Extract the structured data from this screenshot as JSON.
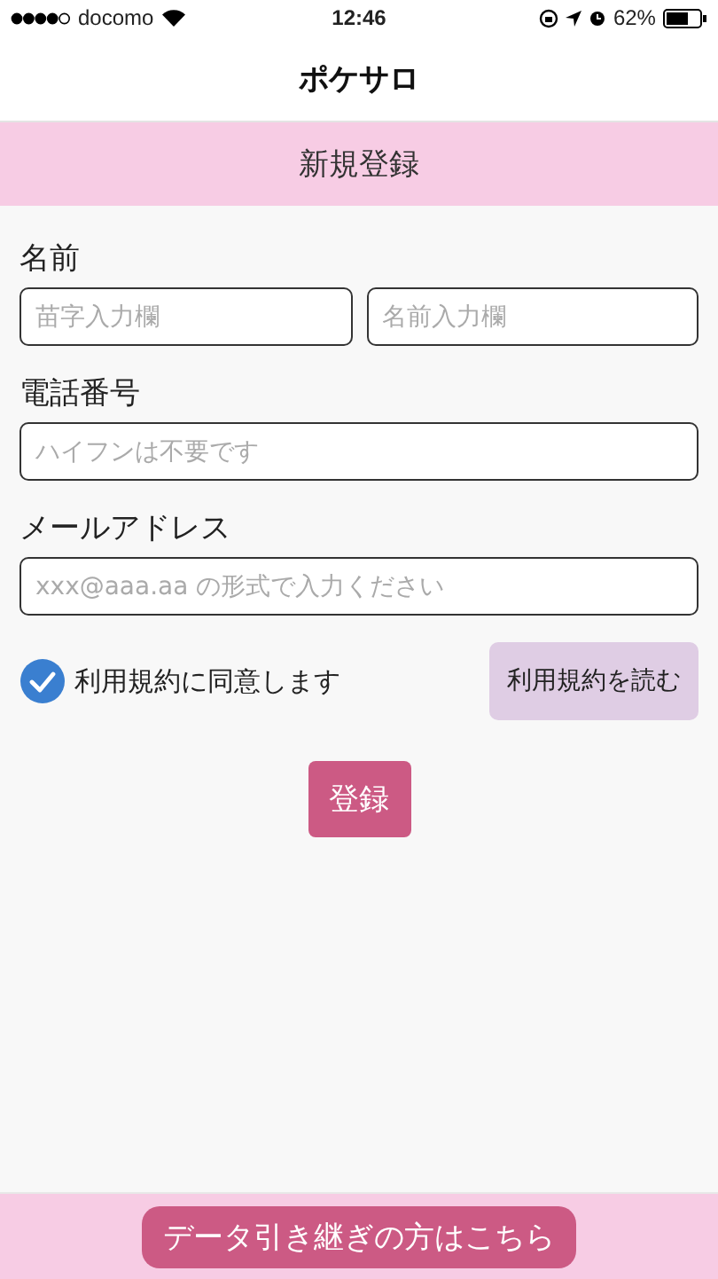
{
  "status_bar": {
    "carrier": "docomo",
    "time": "12:46",
    "battery": "62%"
  },
  "nav_bar": {
    "title": "ポケサロ"
  },
  "header": {
    "title": "新規登録"
  },
  "form": {
    "fields": [
      {
        "label": "名前",
        "inputs": [
          {
            "placeholder": "苗字入力欄"
          },
          {
            "placeholder": "名前入力欄"
          }
        ]
      },
      {
        "label": "電話番号",
        "inputs": [
          {
            "placeholder": "ハイフンは不要です"
          }
        ]
      },
      {
        "label": "メールアドレス",
        "inputs": [
          {
            "placeholder": "xxx@aaa.aa の形式で入力ください"
          }
        ]
      }
    ],
    "agree": {
      "label": "利用規約に同意します",
      "checked": true
    },
    "terms_button": "利用規約を読む",
    "submit_button": "登録"
  },
  "footer": {
    "link_button": "データ引き継ぎの方はこちら"
  }
}
